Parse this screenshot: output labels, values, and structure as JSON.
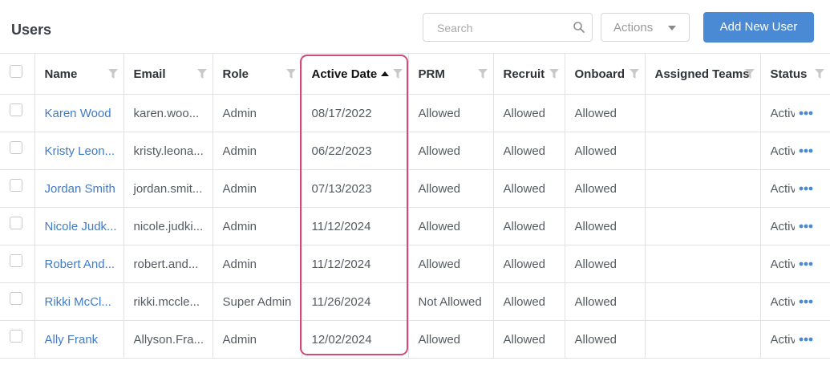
{
  "page": {
    "title": "Users"
  },
  "toolbar": {
    "search_placeholder": "Search",
    "actions_label": "Actions",
    "add_user_label": "Add New User"
  },
  "table": {
    "headers": [
      "Name",
      "Email",
      "Role",
      "Active Date",
      "PRM",
      "Recruit",
      "Onboard",
      "Assigned Teams",
      "Status"
    ],
    "sorted_column": "Active Date",
    "sort_direction": "ascending",
    "rows": [
      {
        "name": "Karen Wood",
        "email": "karen.woo...",
        "role": "Admin",
        "active_date": "08/17/2022",
        "prm": "Allowed",
        "recruit": "Allowed",
        "onboard": "Allowed",
        "teams": "",
        "status": "Active"
      },
      {
        "name": "Kristy Leon...",
        "email": "kristy.leona...",
        "role": "Admin",
        "active_date": "06/22/2023",
        "prm": "Allowed",
        "recruit": "Allowed",
        "onboard": "Allowed",
        "teams": "",
        "status": "Active"
      },
      {
        "name": "Jordan Smith",
        "email": "jordan.smit...",
        "role": "Admin",
        "active_date": "07/13/2023",
        "prm": "Allowed",
        "recruit": "Allowed",
        "onboard": "Allowed",
        "teams": "",
        "status": "Active"
      },
      {
        "name": "Nicole Judk...",
        "email": "nicole.judki...",
        "role": "Admin",
        "active_date": "11/12/2024",
        "prm": "Allowed",
        "recruit": "Allowed",
        "onboard": "Allowed",
        "teams": "",
        "status": "Active"
      },
      {
        "name": "Robert And...",
        "email": "robert.and...",
        "role": "Admin",
        "active_date": "11/12/2024",
        "prm": "Allowed",
        "recruit": "Allowed",
        "onboard": "Allowed",
        "teams": "",
        "status": "Active"
      },
      {
        "name": "Rikki McCl...",
        "email": "rikki.mccle...",
        "role": "Super Admin",
        "active_date": "11/26/2024",
        "prm": "Not Allowed",
        "recruit": "Allowed",
        "onboard": "Allowed",
        "teams": "",
        "status": "Active"
      },
      {
        "name": "Ally Frank",
        "email": "Allyson.Fra...",
        "role": "Admin",
        "active_date": "12/02/2024",
        "prm": "Allowed",
        "recruit": "Allowed",
        "onboard": "Allowed",
        "teams": "",
        "status": "Active"
      }
    ]
  },
  "icons": {
    "search": "search-icon",
    "actions_caret": "caret-down-icon",
    "column_filter": "filter-icon",
    "sort": "sort-ascending-icon",
    "row_menu": "more-horizontal-icon"
  },
  "colors": {
    "accent": "#4a8ad4",
    "link": "#3f7bc7",
    "highlight": "#d4487a"
  }
}
